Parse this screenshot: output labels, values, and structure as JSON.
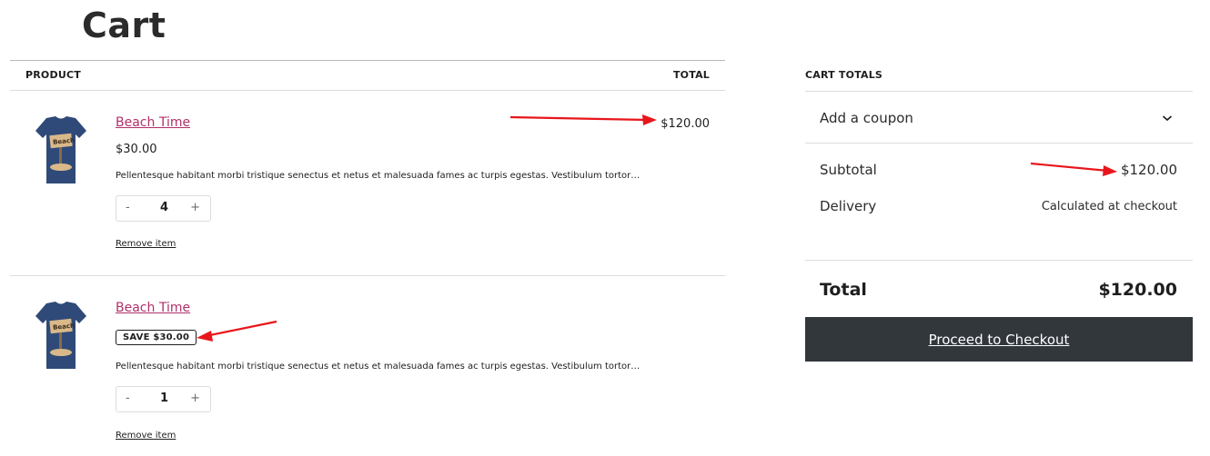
{
  "page": {
    "title": "Cart"
  },
  "table": {
    "product_header": "PRODUCT",
    "total_header": "TOTAL"
  },
  "items": [
    {
      "name": "Beach Time",
      "price": "$30.00",
      "save_badge": "",
      "description": "Pellentesque habitant morbi tristique senectus et netus et malesuada fames ac turpis egestas. Vestibulum tortor…",
      "qty_minus": "-",
      "quantity": "4",
      "qty_plus": "+",
      "remove_label": "Remove item",
      "line_total": "$120.00"
    },
    {
      "name": "Beach Time",
      "price": "",
      "save_badge": "SAVE $30.00",
      "description": "Pellentesque habitant morbi tristique senectus et netus et malesuada fames ac turpis egestas. Vestibulum tortor…",
      "qty_minus": "-",
      "quantity": "1",
      "qty_plus": "+",
      "remove_label": "Remove item",
      "line_total": ""
    }
  ],
  "totals": {
    "header": "CART TOTALS",
    "coupon_label": "Add a coupon",
    "subtotal_label": "Subtotal",
    "subtotal_value": "$120.00",
    "delivery_label": "Delivery",
    "delivery_value": "Calculated at checkout",
    "total_label": "Total",
    "total_value": "$120.00",
    "checkout_label": "Proceed to Checkout"
  },
  "colors": {
    "product_link": "#b0306a",
    "checkout_bg": "#32373c",
    "annotation_arrow": "#e8161b"
  }
}
